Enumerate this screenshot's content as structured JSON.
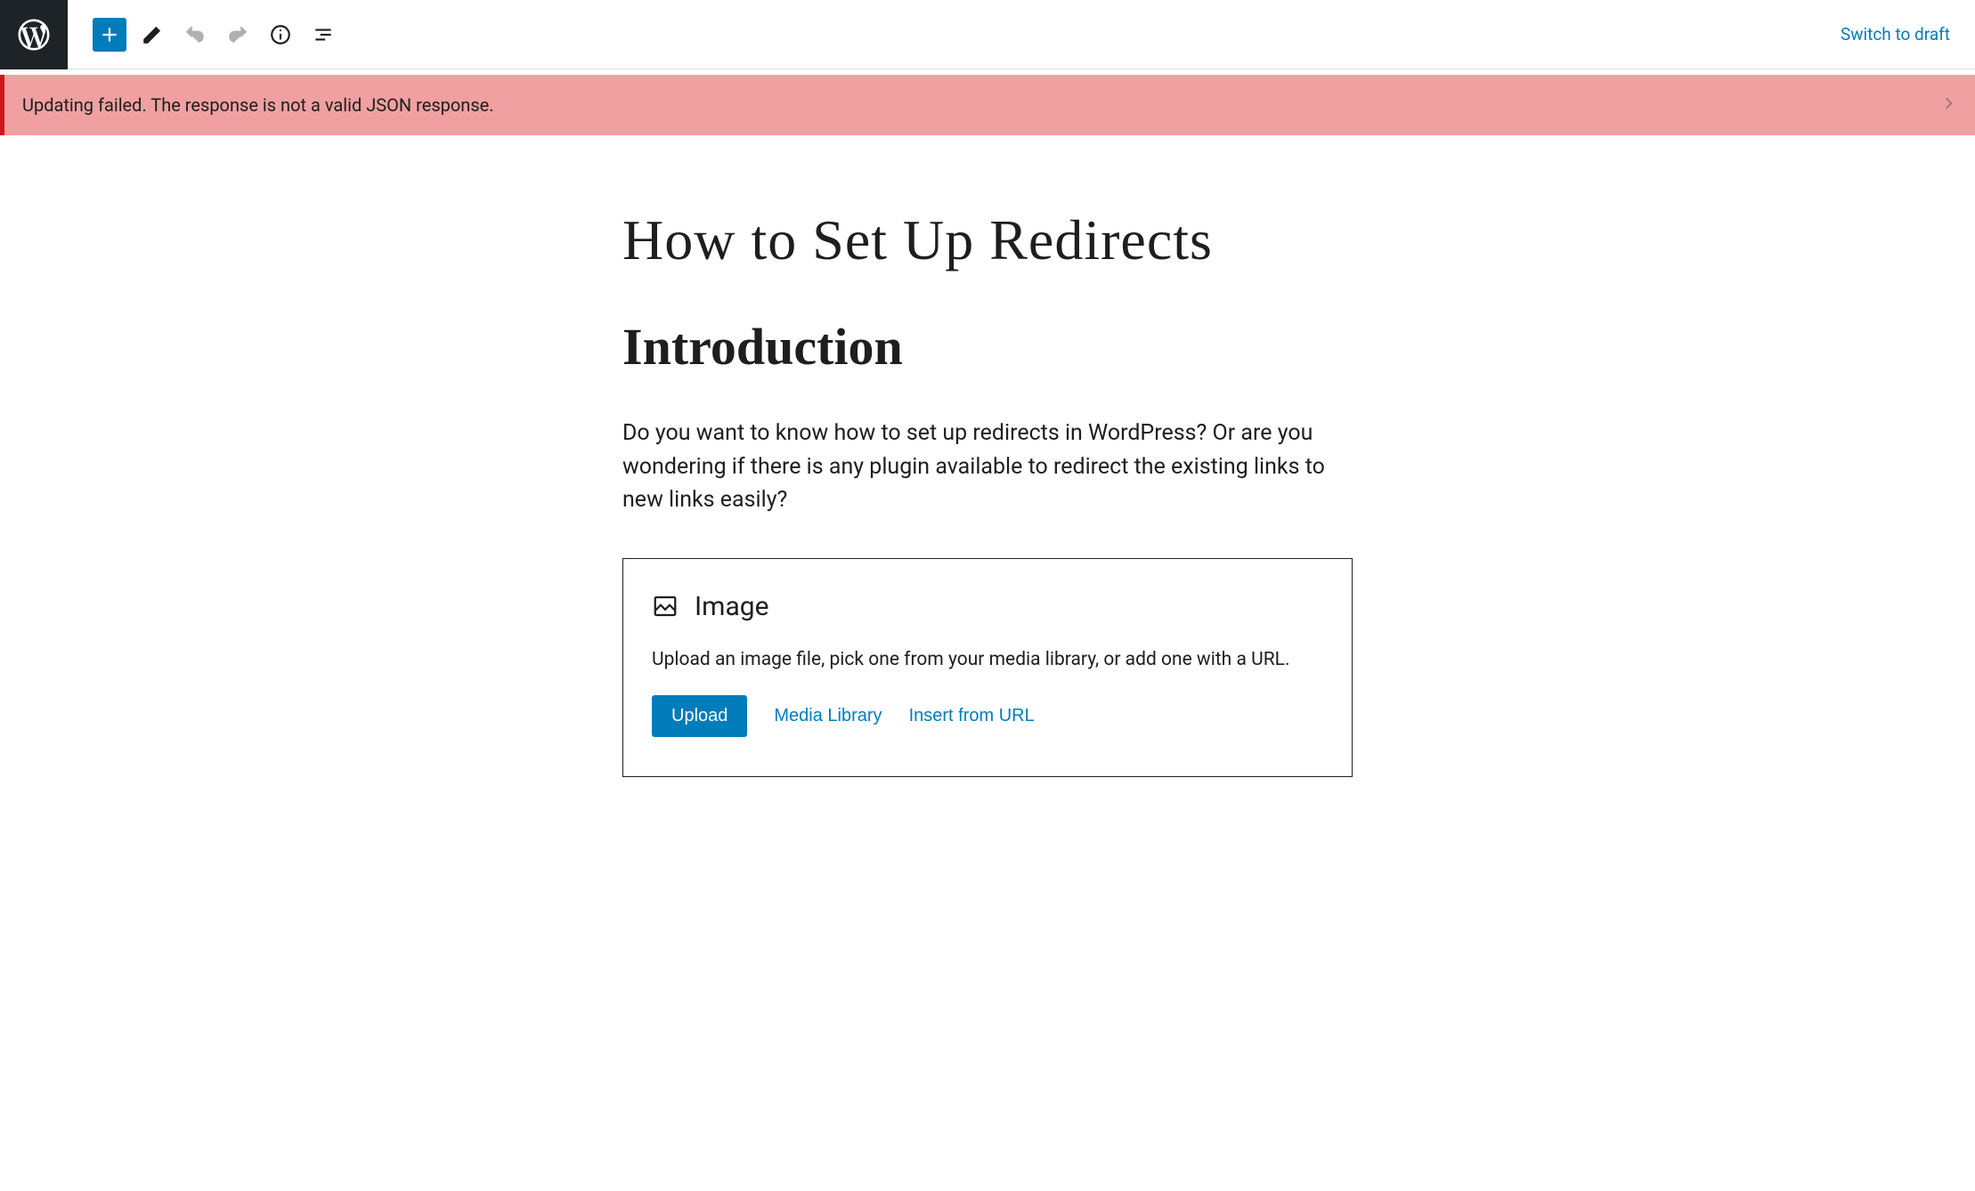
{
  "topbar": {
    "switch_to_draft": "Switch to draft"
  },
  "error": {
    "message": "Updating failed. The response is not a valid JSON response."
  },
  "post": {
    "title": "How to Set Up Redirects",
    "heading": "Introduction",
    "paragraph": "Do you want to know how to set up redirects in WordPress?  Or are you wondering if there is any plugin available to redirect the existing links to new links easily?"
  },
  "image_block": {
    "title": "Image",
    "description": "Upload an image file, pick one from your media library, or add one with a URL.",
    "upload": "Upload",
    "media_library": "Media Library",
    "insert_from_url": "Insert from URL"
  }
}
